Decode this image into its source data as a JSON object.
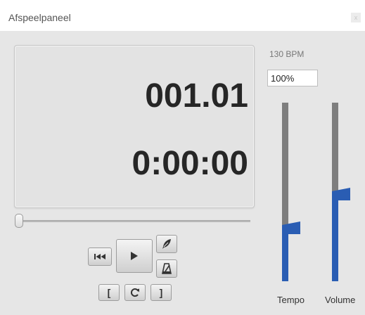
{
  "window": {
    "title": "Afspeelpaneel",
    "close_label": "x"
  },
  "display": {
    "bars_beats": "001.01",
    "time": "0:00:00"
  },
  "position_slider": {
    "value": 0
  },
  "transport": {
    "rewind_icon": "rewind-to-start-icon",
    "play_icon": "play-icon",
    "record_mode_icon": "feather-pen-icon",
    "metronome_icon": "metronome-icon",
    "loop_start_label": "[",
    "loop_icon": "loop-icon",
    "loop_end_label": "]"
  },
  "tempo": {
    "bpm_text": "130 BPM",
    "percent_value": "100%",
    "label": "Tempo",
    "level": 0.31
  },
  "volume": {
    "label": "Volume",
    "level": 0.5
  },
  "colors": {
    "accent": "#2a5db3",
    "track": "#7e7e7e",
    "background": "#e6e6e6"
  }
}
